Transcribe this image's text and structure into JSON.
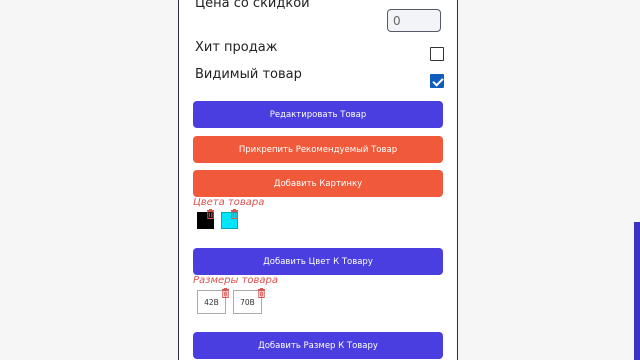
{
  "form": {
    "discount_label": "Цена со скидкой",
    "discount_value": "0",
    "bestseller_label": "Хит продаж",
    "visible_label": "Видимый товар",
    "bestseller_checked": false,
    "visible_checked": true
  },
  "buttons": {
    "edit": "Редактировать Товар",
    "pin_recommended": "Прикрепить Рекомендуемый Товар",
    "add_picture": "Добавить Картинку",
    "add_color": "Добавить Цвет К Товару",
    "add_size": "Добавить Размер К Товару"
  },
  "colors": {
    "title": "Цвета товара",
    "items": [
      {
        "name": "black",
        "hex": "#000000"
      },
      {
        "name": "cyan",
        "hex": "#00e5ff"
      }
    ]
  },
  "sizes": {
    "title": "Размеры товара",
    "items": [
      "42B",
      "70B"
    ]
  },
  "theme": {
    "primary": "#4a3ee0",
    "danger": "#f05a3a",
    "accent_text": "#d9534f",
    "checkbox": "#0f5dbc"
  },
  "icons": {
    "delete": "trash-icon",
    "checked": "checkmark-icon"
  }
}
